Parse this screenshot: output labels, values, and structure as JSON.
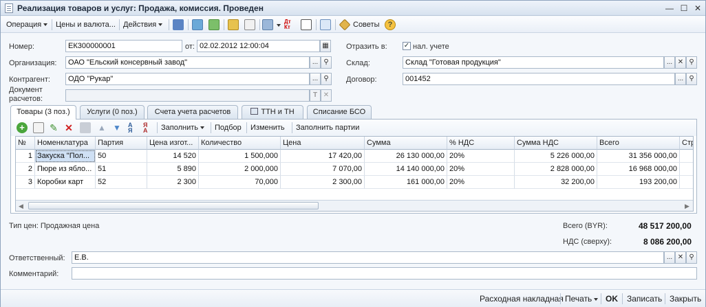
{
  "window": {
    "title": "Реализация товаров и услуг: Продажа, комиссия. Проведен"
  },
  "toolbar": {
    "operation": "Операция",
    "prices_currency": "Цены и валюта...",
    "actions": "Действия",
    "tips": "Советы"
  },
  "header": {
    "number_label": "Номер:",
    "number_value": "ЕК300000001",
    "date_label": "от:",
    "date_value": "02.02.2012 12:00:04",
    "reflect_label": "Отразить в:",
    "tax_accounting_label": "нал. учете",
    "tax_accounting_checked": true,
    "org_label": "Организация:",
    "org_value": "ОАО \"Ельский консервный завод\"",
    "warehouse_label": "Склад:",
    "warehouse_value": "Склад \"Готовая продукция\"",
    "counterparty_label": "Контрагент:",
    "counterparty_value": "ОДО \"Рукар\"",
    "contract_label": "Договор:",
    "contract_value": "001452",
    "settlement_doc_label_1": "Документ",
    "settlement_doc_label_2": "расчетов:",
    "settlement_doc_value": ""
  },
  "tabs": [
    {
      "label": "Товары (3 поз.)",
      "active": true
    },
    {
      "label": "Услуги (0 поз.)",
      "active": false
    },
    {
      "label": "Счета учета расчетов",
      "active": false
    },
    {
      "label": "ТТН и ТН",
      "active": false
    },
    {
      "label": "Списание БСО",
      "active": false
    }
  ],
  "table_toolbar": {
    "fill": "Заполнить",
    "selection": "Подбор",
    "change": "Изменить",
    "fill_batches": "Заполнить партии"
  },
  "table": {
    "columns": [
      "№",
      "Номенклатура",
      "Партия",
      "Цена изгот...",
      "Количество",
      "Цена",
      "Сумма",
      "% НДС",
      "Сумма НДС",
      "Всего",
      "Стр"
    ],
    "rows": [
      [
        "1",
        "Закуска \"Пол...",
        "50",
        "14 520",
        "1 500,000",
        "17 420,00",
        "26 130 000,00",
        "20%",
        "5 226 000,00",
        "31 356 000,00",
        ""
      ],
      [
        "2",
        "Пюре из ябло...",
        "51",
        "5 890",
        "2 000,000",
        "7 070,00",
        "14 140 000,00",
        "20%",
        "2 828 000,00",
        "16 968 000,00",
        ""
      ],
      [
        "3",
        "Коробки карт",
        "52",
        "2 300",
        "70,000",
        "2 300,00",
        "161 000,00",
        "20%",
        "32 200,00",
        "193 200,00",
        ""
      ]
    ]
  },
  "totals": {
    "price_type": "Тип цен: Продажная цена",
    "total_label": "Всего (BYR):",
    "total_value": "48 517 200,00",
    "vat_label": "НДС (сверху):",
    "vat_value": "8 086 200,00"
  },
  "footer_fields": {
    "responsible_label": "Ответственный:",
    "responsible_value": "Е.В.",
    "comment_label": "Комментарий:",
    "comment_value": ""
  },
  "status_bar": {
    "invoice": "Расходная накладная",
    "print": "Печать",
    "ok": "OK",
    "save": "Записать",
    "close": "Закрыть"
  }
}
